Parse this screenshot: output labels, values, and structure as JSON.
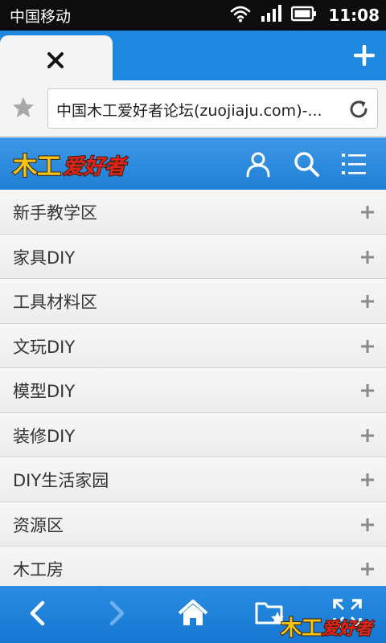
{
  "status_bar": {
    "carrier": "中国移动",
    "time": "11:08"
  },
  "browser": {
    "url_text": "中国木工爱好者论坛(zuojiaju.com)-..."
  },
  "site": {
    "logo_text": "木工爱好者",
    "logo_text_parts": [
      "木工",
      "爱好者"
    ]
  },
  "categories": [
    {
      "label": "新手教学区"
    },
    {
      "label": "家具DIY"
    },
    {
      "label": "工具材料区"
    },
    {
      "label": "文玩DIY"
    },
    {
      "label": "模型DIY"
    },
    {
      "label": "装修DIY"
    },
    {
      "label": "DIY生活家园"
    },
    {
      "label": "资源区"
    },
    {
      "label": "木工房"
    }
  ],
  "colors": {
    "accent_blue": "#1e88e0",
    "header_blue": "#2a86d8",
    "logo_red": "#e0241c",
    "logo_yellow": "#f4c416"
  },
  "icons": {
    "status": [
      "wifi-icon",
      "signal-icon",
      "battery-icon"
    ],
    "tab": [
      "close-icon",
      "add-tab-icon"
    ],
    "address": [
      "star-icon",
      "reload-icon"
    ],
    "header": [
      "user-icon",
      "search-icon",
      "menu-icon"
    ],
    "list": "plus-icon",
    "bottom": [
      "back-icon",
      "forward-icon",
      "home-icon",
      "bookmarks-folder-icon",
      "fullscreen-icon"
    ]
  }
}
